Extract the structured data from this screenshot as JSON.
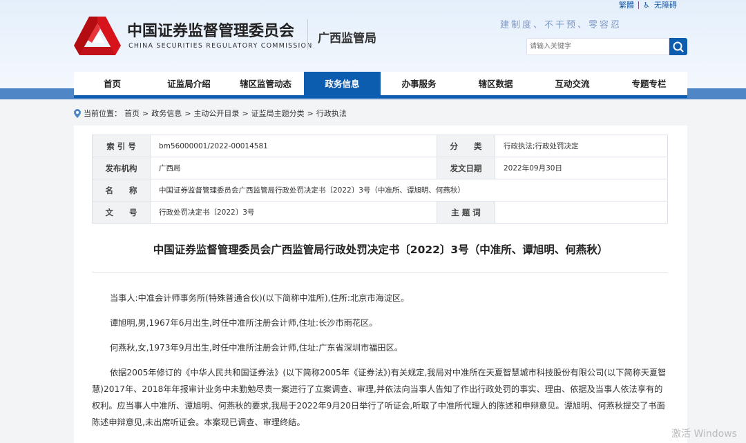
{
  "header": {
    "org_name_cn": "中国证券监督管理委员会",
    "org_name_en": "CHINA SECURITIES REGULATORY COMMISSION",
    "bureau": "广西监管局",
    "slogan": "建制度、不干预、零容忍",
    "links": {
      "traditional": "繁體",
      "accessible": "无障碍"
    },
    "search": {
      "placeholder": "请输入关键字"
    }
  },
  "nav": [
    "首页",
    "证监局介绍",
    "辖区监管动态",
    "政务信息",
    "办事服务",
    "辖区数据",
    "互动交流",
    "专题专栏"
  ],
  "breadcrumb": {
    "prefix": "当前位置：",
    "items": [
      "首页",
      ">",
      "政务信息",
      ">",
      "主动公开目录",
      ">",
      "证监局主题分类",
      ">",
      "行政执法"
    ]
  },
  "meta": {
    "index_label": "索 引 号",
    "index_value": "bm56000001/2022-00014581",
    "category_label": "分　　类",
    "category_value": "行政执法;行政处罚决定",
    "issuer_label": "发布机构",
    "issuer_value": "广西局",
    "date_label": "发文日期",
    "date_value": "2022年09月30日",
    "name_label": "名　　称",
    "name_value": "中国证券监督管理委员会广西监管局行政处罚决定书〔2022〕3号（中准所、谭旭明、何燕秋）",
    "docno_label": "文　　号",
    "docno_value": "行政处罚决定书〔2022〕3号",
    "keywords_label": "主 题 词",
    "keywords_value": ""
  },
  "article": {
    "title": "中国证券监督管理委员会广西监管局行政处罚决定书〔2022〕3号（中准所、谭旭明、何燕秋）",
    "paragraphs": [
      "当事人:中准会计师事务所(特殊普通合伙)(以下简称中准所),住所:北京市海淀区。",
      "谭旭明,男,1967年6月出生,时任中准所注册会计师,住址:长沙市雨花区。",
      "何燕秋,女,1973年9月出生,时任中准所注册会计师,住址:广东省深圳市福田区。",
      "依据2005年修订的《中华人民共和国证券法》(以下简称2005年《证券法》)有关规定,我局对中准所在天夏智慧城市科技股份有限公司(以下简称天夏智慧)2017年、2018年年报审计业务中未勤勉尽责一案进行了立案调查、审理,并依法向当事人告知了作出行政处罚的事实、理由、依据及当事人依法享有的权利。应当事人中准所、谭旭明、何燕秋的要求,我局于2022年9月20日举行了听证会,听取了中准所代理人的陈述和申辩意见。谭旭明、何燕秋提交了书面陈述申辩意见,未出席听证会。本案现已调查、审理终结。"
    ]
  },
  "watermark": "激活 Windows",
  "colors": {
    "primary": "#0c5db0",
    "logo_red": "#d7141b"
  }
}
